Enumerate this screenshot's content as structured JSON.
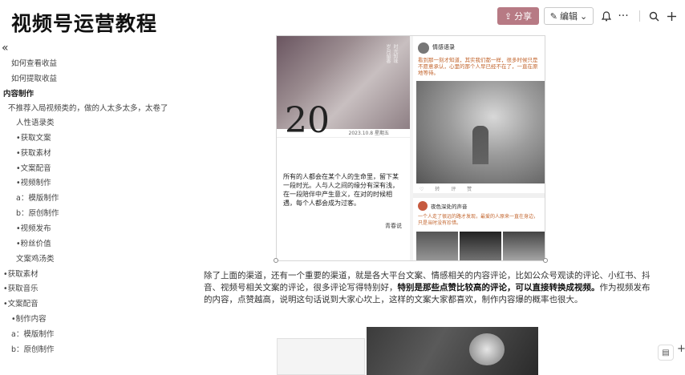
{
  "document": {
    "title": "视频号运营教程"
  },
  "toolbar": {
    "share_label": "分享",
    "share_icon": "share-icon",
    "edit_label": "编辑",
    "more_label": "···",
    "accent_color": "#b77a84"
  },
  "sidebar": {
    "collapse_icon": "«",
    "items": [
      {
        "label": "如何查看收益",
        "indent": 1,
        "bold": false
      },
      {
        "label": "如何提取收益",
        "indent": 1,
        "bold": false
      },
      {
        "label": "内容制作",
        "indent": 0,
        "bold": true
      },
      {
        "label": "不推荐入局视频类的，做的人太多太多，太卷了",
        "indent": 1,
        "bold": false
      },
      {
        "label": "人性语录类",
        "indent": 2,
        "bold": false
      },
      {
        "label": "•获取文案",
        "indent": 2,
        "bold": false
      },
      {
        "label": "•获取素材",
        "indent": 2,
        "bold": false
      },
      {
        "label": "•文案配音",
        "indent": 2,
        "bold": false
      },
      {
        "label": "•视频制作",
        "indent": 2,
        "bold": false
      },
      {
        "label": "a：模版制作",
        "indent": 2,
        "bold": false
      },
      {
        "label": "b：原创制作",
        "indent": 2,
        "bold": false
      },
      {
        "label": "•视频发布",
        "indent": 2,
        "bold": false
      },
      {
        "label": "•粉丝价值",
        "indent": 2,
        "bold": false
      },
      {
        "label": "文案鸡汤类",
        "indent": 2,
        "bold": false
      },
      {
        "label": "•获取素材",
        "indent": 0,
        "bold": false
      },
      {
        "label": "•获取音乐",
        "indent": 0,
        "bold": false
      },
      {
        "label": "•文案配音",
        "indent": 0,
        "bold": false
      },
      {
        "label": "•制作内容",
        "indent": 1,
        "bold": false
      },
      {
        "label": "a：模版制作",
        "indent": 1,
        "bold": false
      },
      {
        "label": "b：原创制作",
        "indent": 1,
        "bold": false
      }
    ]
  },
  "content": {
    "image_card": {
      "big_number": "20",
      "number_caption": "2023.10.8 星期五",
      "quote": "所有的人都会在某个人的生命里，留下某一段时光。人与人之间的缘分有深有浅，在一段陪伴中产生意义，在对的时候相遇，每个人都会成为过客。",
      "quote_author": "青春说",
      "poster_name": "情感语录",
      "poster_text": "看到那一刻才知道，其实我们都一样，很多时候只是不愿意承认，心里的那个人早已经不在了，一直在原地等待。",
      "stats": "♡ 转 评 赞",
      "poster2_name": "夜色深处的声音",
      "poster2_text": "一个人走了很远的路才发现，最爱的人原来一直在身边，只是当时没有珍惜。"
    },
    "paragraph_before": "除了上面的渠道，还有一个重要的渠道，就是各大平台文案、情感相关的内容评论，比如公众号观读的评论、小红书、抖音、视频号相关文案的评论，很多评论写得特别好，",
    "paragraph_bold": "特别是那些点赞比较高的评论，可以直接转换成视频。",
    "paragraph_after": "作为视频发布的内容，点赞越高，说明这句话说到大家心坎上，这样的文案大家都喜欢，制作内容爆的概率也很大。"
  }
}
